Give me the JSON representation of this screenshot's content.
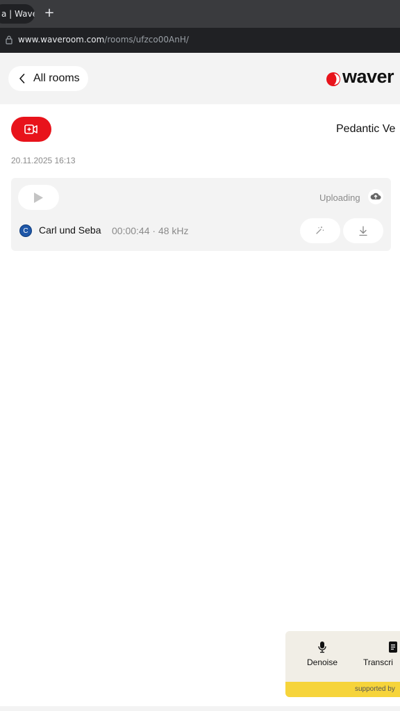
{
  "browser": {
    "tab_title": "a | Waver",
    "new_tab": "+",
    "url_host": "www.waveroom.com",
    "url_path": "/rooms/ufzco00AnH/"
  },
  "header": {
    "back_label": "All rooms",
    "logo_text": "waver"
  },
  "room": {
    "name": "Pedantic Ve",
    "date": "20.11.2025 16:13"
  },
  "recording": {
    "status": "Uploading",
    "avatar_letter": "C",
    "track_name": "Carl und Seba",
    "track_meta": "00:00:44 · 48 kHz"
  },
  "tools": {
    "denoise_label": "Denoise",
    "transcribe_label": "Transcri",
    "supported_label": "supported by"
  },
  "colors": {
    "accent": "#e8131b",
    "avatar": "#1f57a8",
    "supported_bar": "#f6d43b"
  }
}
